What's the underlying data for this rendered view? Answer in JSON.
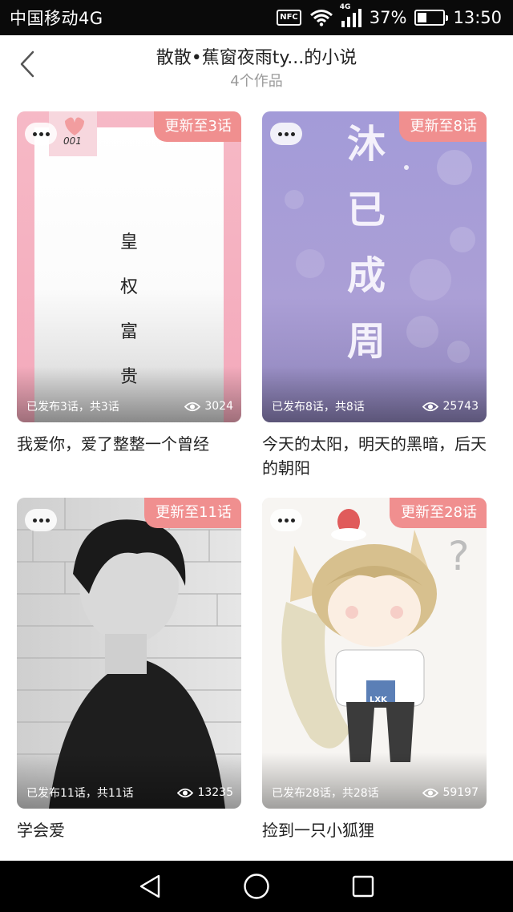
{
  "status_bar": {
    "carrier": "中国移动4G",
    "nfc": "NFC",
    "network_type": "4G",
    "battery_percent": "37%",
    "battery_level": 0.37,
    "time": "13:50"
  },
  "header": {
    "title": "散散•蕉窗夜雨ty...的小说",
    "subtitle": "4个作品"
  },
  "works": [
    {
      "update_tag": "更新至3话",
      "published": "已发布3话，共3话",
      "views": "3024",
      "title": "我爱你，爱了整整一个曾经",
      "cover_text": [
        "皇",
        "权",
        "富",
        "贵"
      ],
      "cover_badge": "001"
    },
    {
      "update_tag": "更新至8话",
      "published": "已发布8话，共8话",
      "views": "25743",
      "title": "今天的太阳，明天的黑暗，后天的朝阳",
      "cover_text": [
        "沐",
        "已",
        "成",
        "周"
      ]
    },
    {
      "update_tag": "更新至11话",
      "published": "已发布11话，共11话",
      "views": "13235",
      "title": "学会爱"
    },
    {
      "update_tag": "更新至28话",
      "published": "已发布28话，共28话",
      "views": "59197",
      "title": "捡到一只小狐狸",
      "cover_text": [
        "LXK"
      ]
    }
  ],
  "colors": {
    "accent": "#f08f8f",
    "status_bar_bg": "#0a0a0a",
    "nav_bar_bg": "#000000"
  },
  "icons": {
    "back": "chevron-left-icon",
    "more": "more-dots-icon",
    "views": "eye-icon",
    "nav_back": "triangle-back-icon",
    "nav_home": "circle-home-icon",
    "nav_recent": "square-recent-icon"
  }
}
